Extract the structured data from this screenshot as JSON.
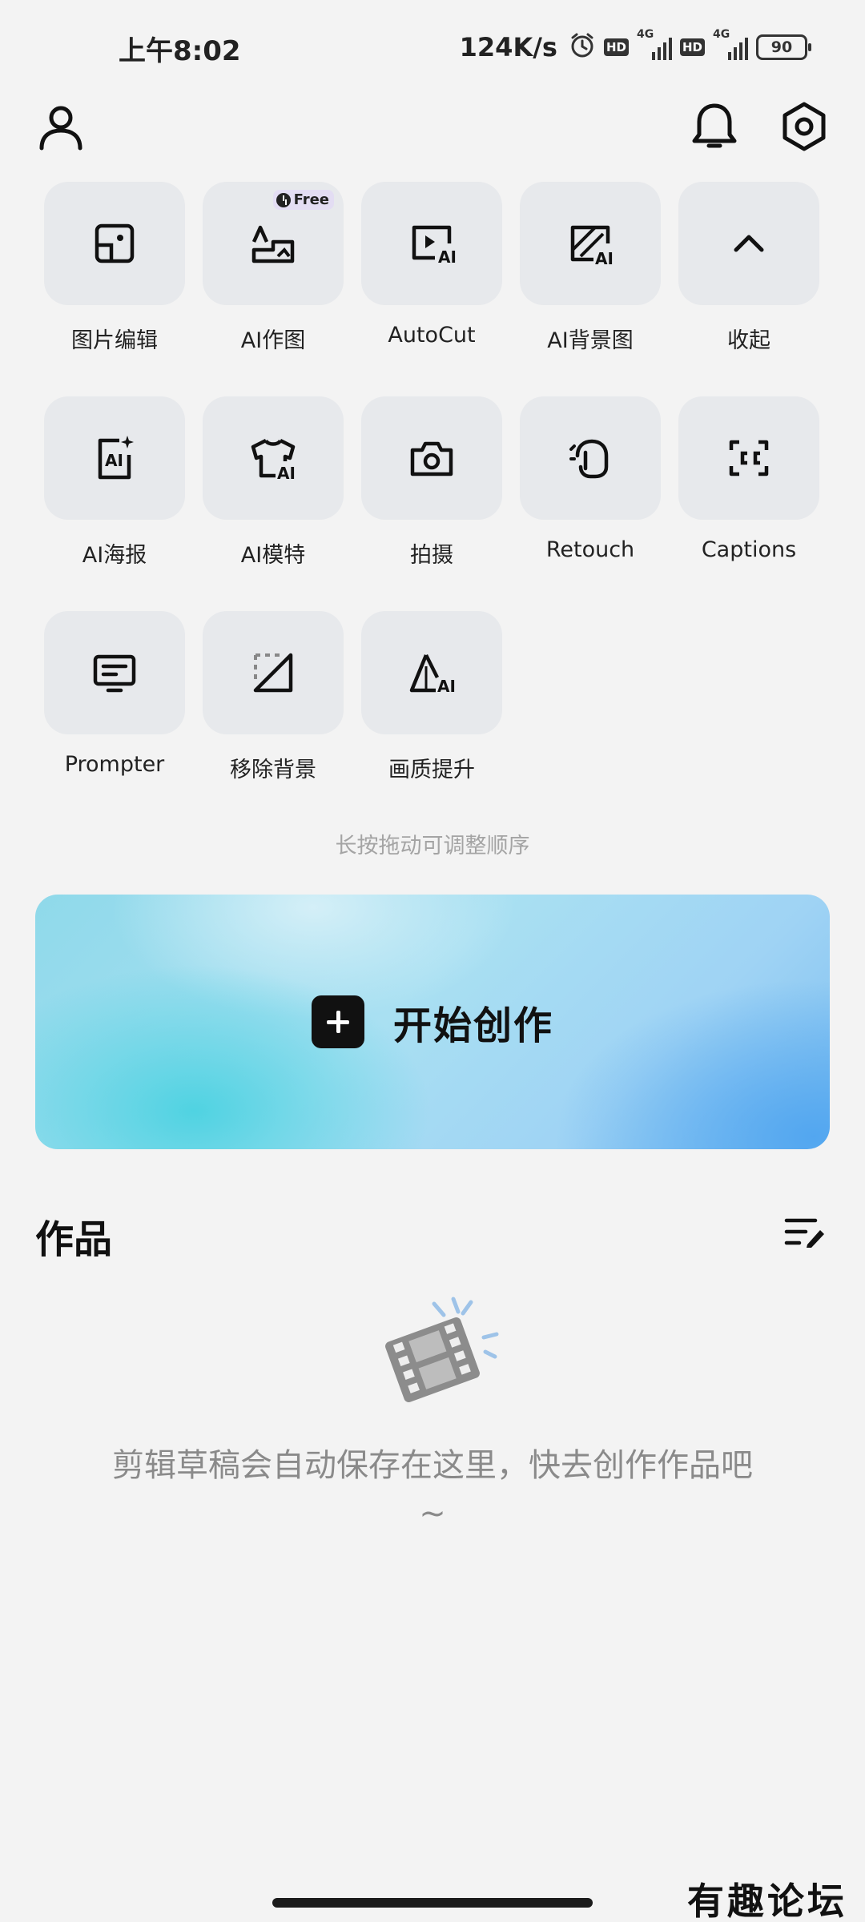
{
  "status_bar": {
    "time": "上午8:02",
    "net_speed": "124K/s",
    "hd1": "HD",
    "sim1_tag": "4G",
    "hd2": "HD",
    "sim2_tag": "4G",
    "battery": "90",
    "icons": [
      "alarm-icon",
      "signal-icon",
      "battery-icon"
    ]
  },
  "header": {
    "left_icon": "profile-icon",
    "right_icons": [
      "bell-icon",
      "settings-icon"
    ]
  },
  "tools": [
    {
      "label": "图片编辑",
      "icon": "image-edit-icon"
    },
    {
      "label": "AI作图",
      "icon": "ai-draw-icon",
      "badge": "Free"
    },
    {
      "label": "AutoCut",
      "icon": "autocut-icon"
    },
    {
      "label": "AI背景图",
      "icon": "ai-background-icon"
    },
    {
      "label": "收起",
      "icon": "chevron-up-icon"
    },
    {
      "label": "AI海报",
      "icon": "ai-poster-icon"
    },
    {
      "label": "AI模特",
      "icon": "ai-model-icon"
    },
    {
      "label": "拍摄",
      "icon": "camera-icon"
    },
    {
      "label": "Retouch",
      "icon": "retouch-icon"
    },
    {
      "label": "Captions",
      "icon": "captions-icon"
    },
    {
      "label": "Prompter",
      "icon": "prompter-icon"
    },
    {
      "label": "移除背景",
      "icon": "remove-background-icon"
    },
    {
      "label": "画质提升",
      "icon": "enhance-quality-icon"
    }
  ],
  "hint": "长按拖动可调整顺序",
  "create": {
    "label": "开始创作"
  },
  "works": {
    "title": "作品",
    "empty_text": "剪辑草稿会自动保存在这里，快去创作作品吧~"
  },
  "watermark": "有趣论坛"
}
